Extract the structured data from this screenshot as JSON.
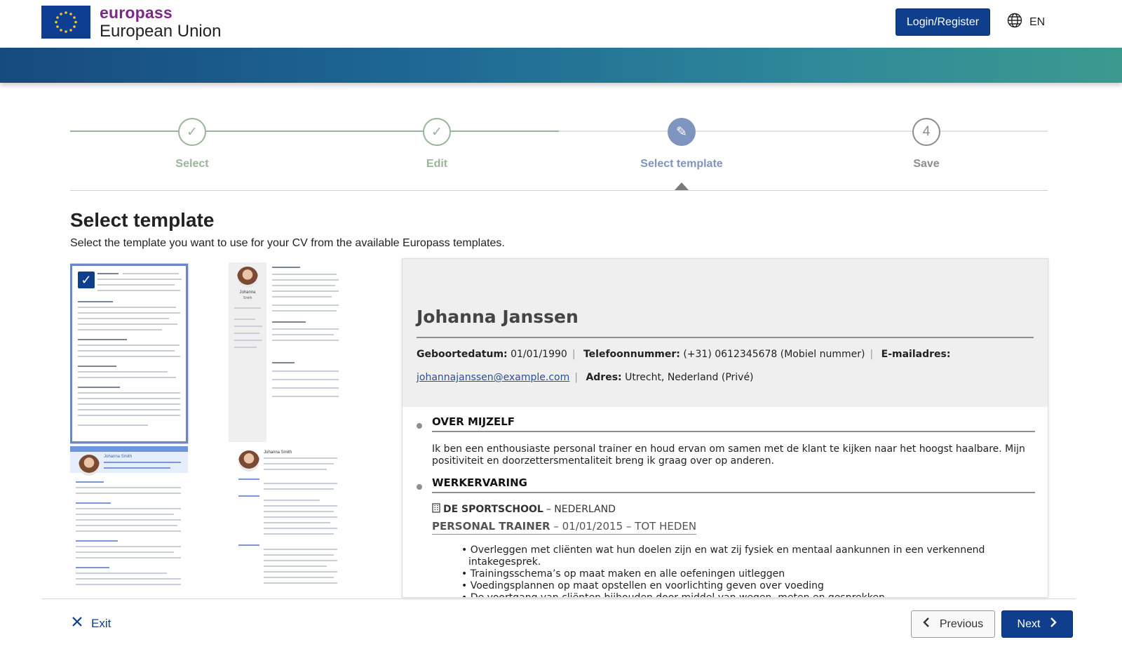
{
  "header": {
    "brand_name": "europass",
    "brand_sub": "European Union",
    "login_label": "Login/Register",
    "language": "EN"
  },
  "stepper": {
    "steps": [
      {
        "label": "Select",
        "state": "done",
        "symbol": "✓"
      },
      {
        "label": "Edit",
        "state": "done",
        "symbol": "✓"
      },
      {
        "label": "Select template",
        "state": "active",
        "symbol": "✎"
      },
      {
        "label": "Save",
        "state": "todo",
        "symbol": "4"
      }
    ],
    "colors": {
      "done": "#9bb59b",
      "active": "#7f94bf",
      "todo": "#8d8d8d"
    }
  },
  "main": {
    "title": "Select template",
    "subtitle": "Select the template you want to use for your CV from the available Europass templates."
  },
  "thumbnails": {
    "selected_index": 0,
    "thumb2_name": "Johanna",
    "thumb2_surname": "Smith",
    "thumb3_name": "Johanna Smith",
    "thumb4_name": "Johanna Smith"
  },
  "preview": {
    "name": "Johanna Janssen",
    "birth_label": "Geboortedatum:",
    "birth_value": "01/01/1990",
    "phone_label": "Telefoonnummer:",
    "phone_value": "(+31) 0612345678 (Mobiel nummer)",
    "email_label": "E-mailadres:",
    "email_value": "johannajanssen@example.com",
    "address_label": "Adres:",
    "address_value": "Utrecht, Nederland (Privé)",
    "about_heading": "OVER MIJZELF",
    "about_text": "Ik ben een enthousiaste personal trainer en houd ervan om samen met de klant te kijken naar het hoogst haalbare. Mijn positiviteit en doorzettersmentaliteit breng ik graag over op anderen.",
    "work_heading": "WERKERVARING",
    "employer": "DE SPORTSCHOOL",
    "employer_country": "– NEDERLAND",
    "job_title": "PERSONAL TRAINER",
    "job_period": "– 01/01/2015 – TOT HEDEN",
    "duties": [
      "Overleggen met cliënten wat hun doelen zijn en wat zij fysiek en mentaal aankunnen in een verkennend intakegesprek.",
      "Trainingsschema’s op maat maken en alle oefeningen uitleggen",
      "Voedingsplannen op maat opstellen en voorlichting geven over voeding",
      "De voortgang van cliënten bijhouden door middel van wegen, meten en gesprekken"
    ]
  },
  "footer": {
    "exit_label": "Exit",
    "previous_label": "Previous",
    "next_label": "Next"
  }
}
